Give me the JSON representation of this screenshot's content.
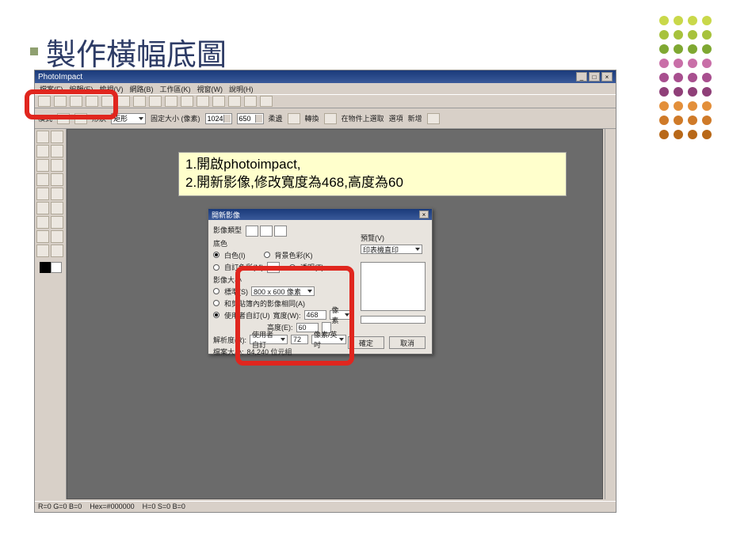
{
  "dot_colors": [
    "#c9d84a",
    "#c9d84a",
    "#c9d84a",
    "#c9d84a",
    "#a7c23c",
    "#a7c23c",
    "#a7c23c",
    "#a7c23c",
    "#7fa832",
    "#7fa832",
    "#7fa832",
    "#7fa832",
    "#c96fa8",
    "#c96fa8",
    "#c96fa8",
    "#c96fa8",
    "#a84f8f",
    "#a84f8f",
    "#a84f8f",
    "#a84f8f",
    "#8f3f78",
    "#8f3f78",
    "#8f3f78",
    "#8f3f78",
    "#e38f3a",
    "#e38f3a",
    "#e38f3a",
    "#e38f3a",
    "#cf7a28",
    "#cf7a28",
    "#cf7a28",
    "#cf7a28",
    "#b86818",
    "#b86818",
    "#b86818",
    "#b86818"
  ],
  "slide": {
    "title": "製作橫幅底圖"
  },
  "app": {
    "title": "PhotoImpact",
    "menubar": [
      "檔案(F)",
      "編輯(E)",
      "檢視(V)",
      "網路(B)",
      "工作區(K)",
      "視窗(W)",
      "說明(H)"
    ],
    "toolbar2": {
      "mode_label": "模式",
      "shape_label": "形狀",
      "shape_value": "矩形",
      "size_label": "固定大小 (像素)",
      "width": "1024",
      "height": "650",
      "soft_label": "柔邊",
      "trans_label": "轉換",
      "keep_label": "在物件上選取",
      "opt_label": "選項",
      "new_label": "新增"
    },
    "status": {
      "rgb": "R=0 G=0 B=0",
      "hex": "Hex=#000000",
      "hsb": "H=0 S=0 B=0"
    }
  },
  "note": {
    "line1": "1.開啟photoimpact,",
    "line2": "2.開新影像,修改寬度為468,高度為60"
  },
  "dialog": {
    "title": "開新影像",
    "sect_type": "影像類型",
    "sect_base": "底色",
    "base_white": "白色(I)",
    "base_bg": "背景色彩(K)",
    "base_custom": "自訂色彩(M)",
    "base_trans": "透明(T)",
    "sect_size": "影像大小",
    "std_label": "標準(S)",
    "std_value": "800 x 600 像素",
    "same_label": "和剪貼簿內的影像相同(A)",
    "user_label": "使用者自訂(U)",
    "width_label": "寬度(W):",
    "width_value": "468",
    "width_unit": "像素",
    "height_label": "高度(E):",
    "height_value": "60",
    "res_label": "解析度(R):",
    "res_mode": "使用者自訂",
    "res_value": "72",
    "res_unit": "像素/英吋",
    "filesize_label": "檔案大小:",
    "filesize_value": "84,240 位元組",
    "preview_label": "預覽(V)",
    "preview_drop": "印表機直印",
    "ok": "確定",
    "cancel": "取消"
  }
}
